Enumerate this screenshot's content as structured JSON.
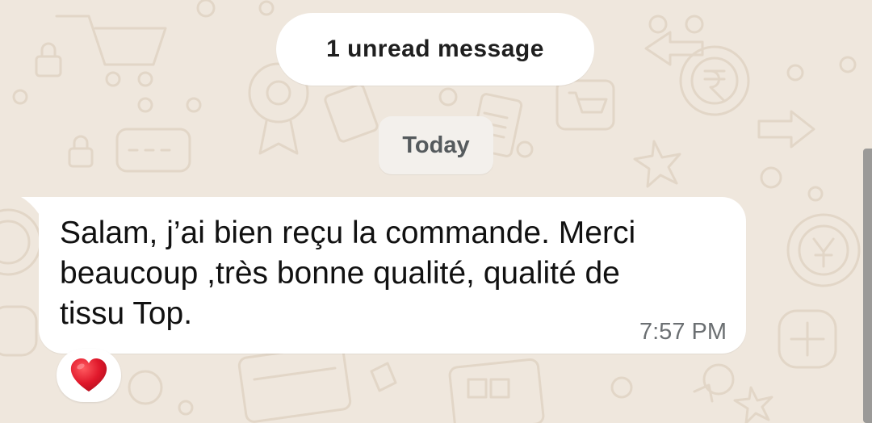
{
  "unread_banner": {
    "text": "1 unread message"
  },
  "date_chip": {
    "label": "Today"
  },
  "message": {
    "text": "Salam, j’ai bien reçu la commande. Merci\nbeaucoup ,très bonne qualité, qualité de\ntissu Top.",
    "time": "7:57 PM",
    "reaction_icon": "red-heart-icon"
  },
  "colors": {
    "wallpaper": "#efe7dd",
    "doodle": "#e3d8ca",
    "bubble": "#ffffff",
    "heart": "#e0182b"
  }
}
